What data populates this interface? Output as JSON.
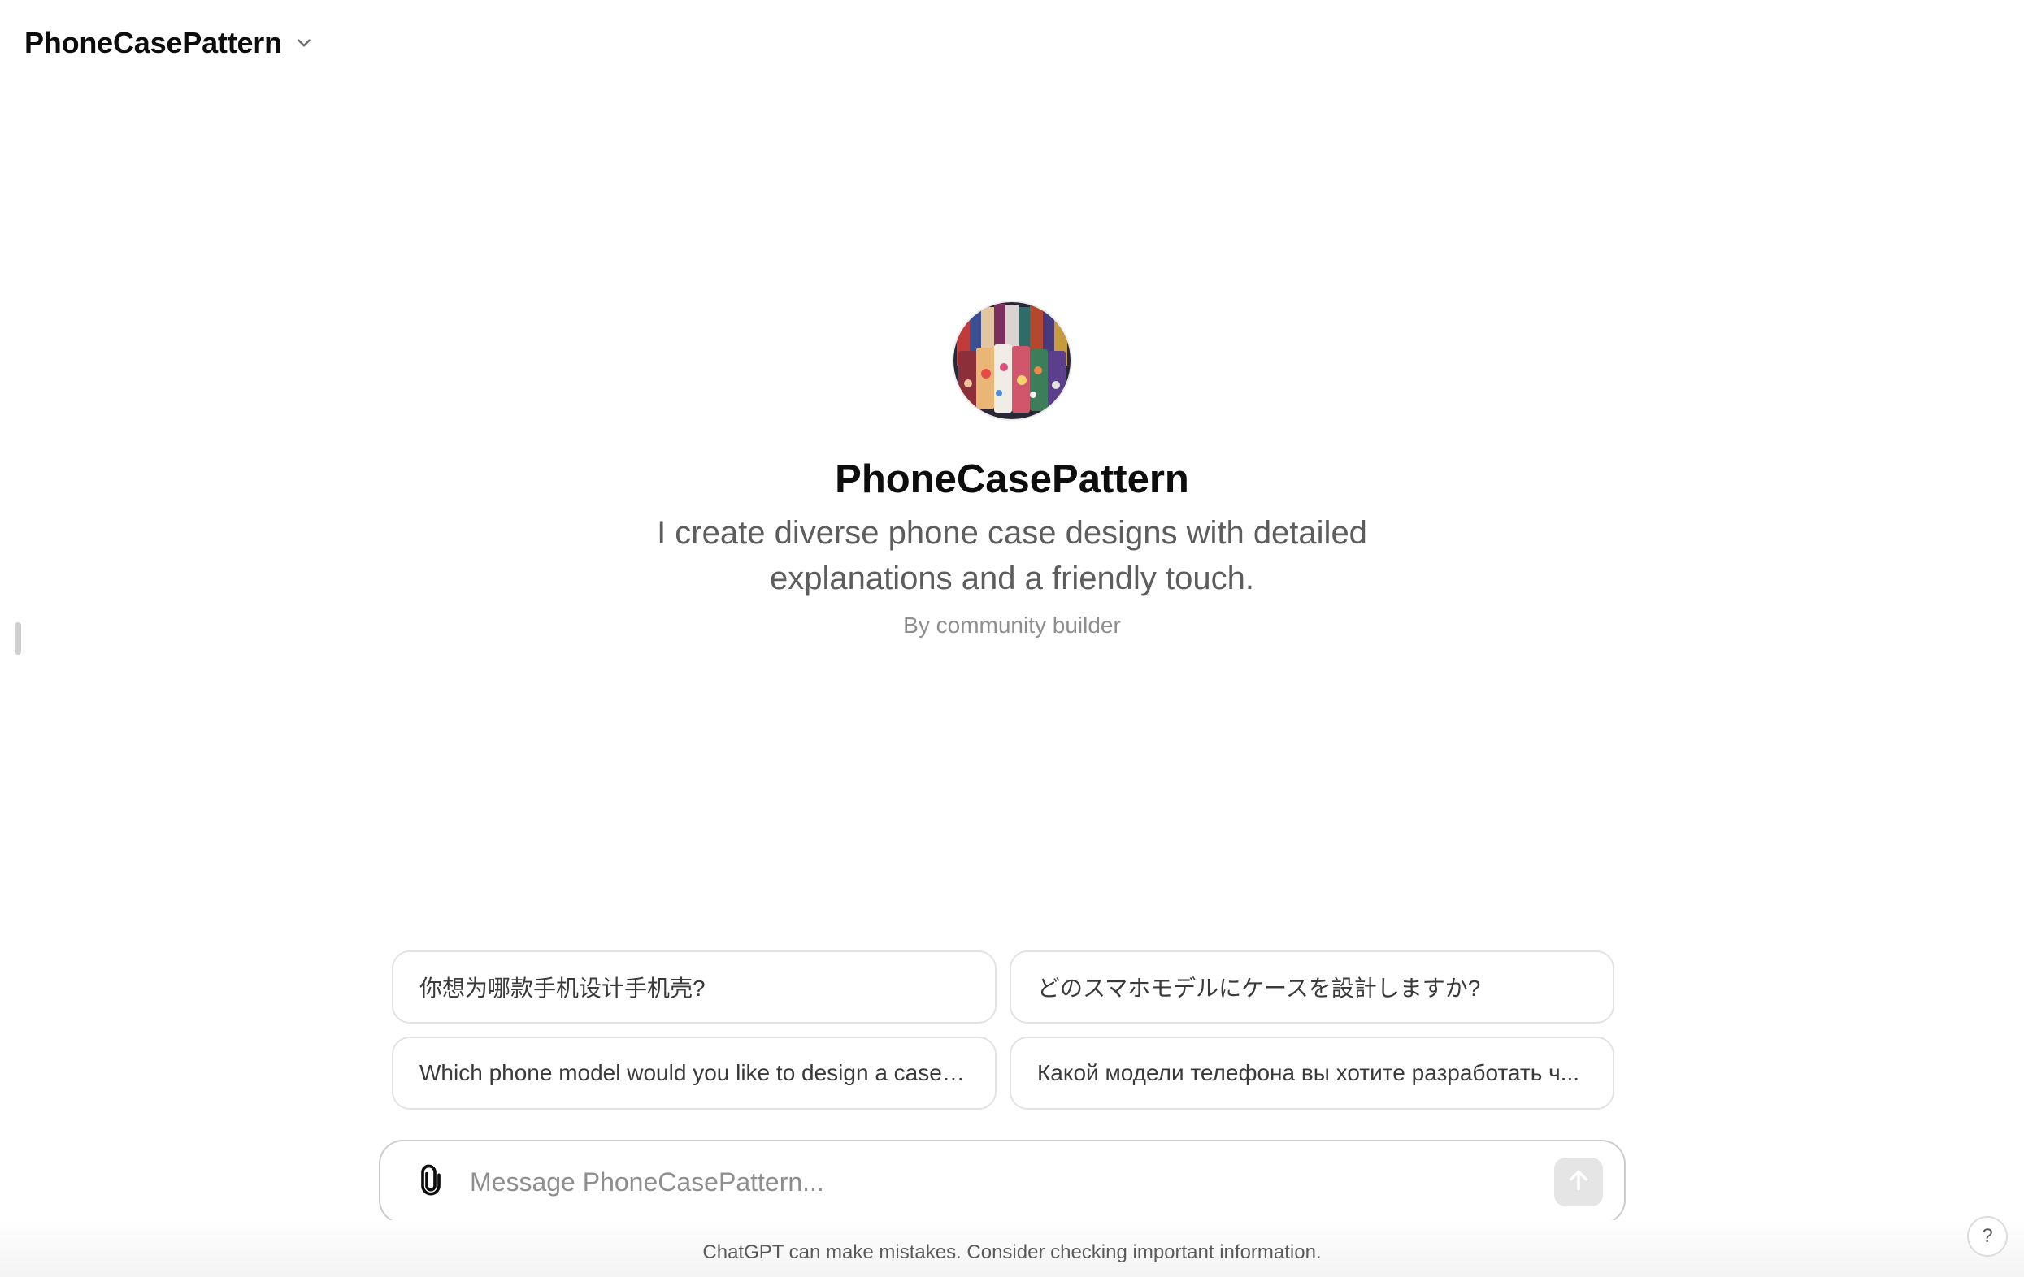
{
  "header": {
    "model_name": "PhoneCasePattern",
    "dropdown_icon": "chevron-down-icon"
  },
  "gpt": {
    "avatar_icon": "phone-case-collage-avatar",
    "title": "PhoneCasePattern",
    "description": "I create diverse phone case designs with detailed explanations and a friendly touch.",
    "author": "By community builder"
  },
  "suggestions": [
    {
      "label": "你想为哪款手机设计手机壳?"
    },
    {
      "label": "どのスマホモデルにケースを設計しますか?"
    },
    {
      "label": "Which phone model would you like to design a case f..."
    },
    {
      "label": "Какой модели телефона вы хотите разработать ч..."
    }
  ],
  "composer": {
    "placeholder": "Message PhoneCasePattern...",
    "value": "",
    "attach_icon": "paperclip-icon",
    "send_icon": "arrow-up-icon"
  },
  "footer": {
    "disclaimer": "ChatGPT can make mistakes. Consider checking important information.",
    "help_label": "?"
  },
  "colors": {
    "text_primary": "#0d0d0d",
    "text_secondary": "#5d5d5d",
    "text_muted": "#8e8e8e",
    "border": "#e3e3e3",
    "send_disabled": "#e5e5e5"
  }
}
